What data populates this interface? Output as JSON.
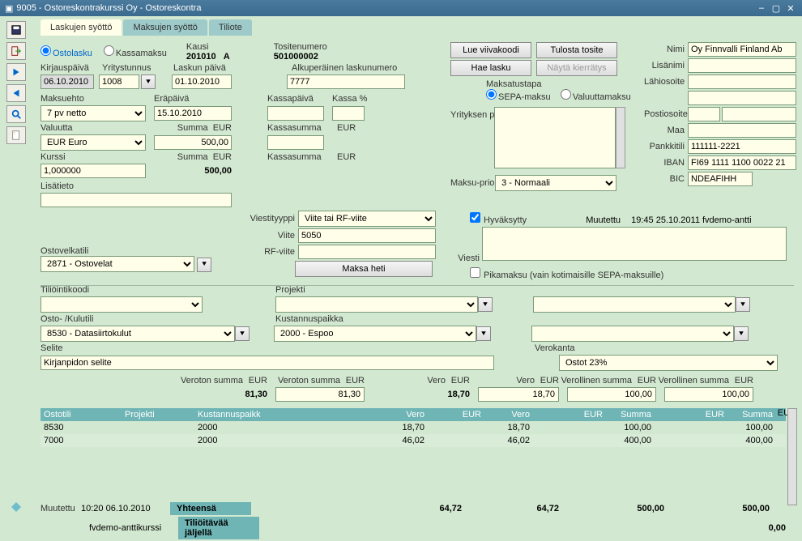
{
  "window": {
    "title": "9005 - Ostoreskontrakurssi Oy - Ostoreskontra"
  },
  "tabs": [
    "Laskujen syöttö",
    "Maksujen syöttö",
    "Tiliote"
  ],
  "radios": {
    "ostolasku": "Ostolasku",
    "kassamaksu": "Kassamaksu"
  },
  "lbl": {
    "kausi": "Kausi",
    "tositenumero": "Tositenumero",
    "kirjauspaiva": "Kirjauspäivä",
    "yritystunnus": "Yritystunnus",
    "laskunpaiva": "Laskun päivä",
    "alkuperainen": "Alkuperäinen laskunumero",
    "maksuehto": "Maksuehto",
    "erapaiva": "Eräpäivä",
    "kassapaiva": "Kassapäivä",
    "kassapct": "Kassa %",
    "valuutta": "Valuutta",
    "summa": "Summa",
    "kurssi": "Kurssi",
    "kassasumma": "Kassasumma",
    "lisatieto": "Lisätieto",
    "viestityyppi": "Viestityyppi",
    "viite": "Viite",
    "rfviite": "RF-viite",
    "ostovelkatili": "Ostovelkatili",
    "maksatapa": "Maksatustapa",
    "sepa": "SEPA-maksu",
    "valuutta_r": "Valuuttamaksu",
    "yrityksen": "Yrityksen pankkitilit",
    "maksupri": "Maksu-prioriteetti",
    "nimi": "Nimi",
    "lisanimi": "Lisänimi",
    "lahiosoite": "Lähiosoite",
    "postiosoite": "Postiosoite",
    "maa": "Maa",
    "pankkitili": "Pankkitili",
    "iban": "IBAN",
    "bic": "BIC",
    "hyvaksytty": "Hyväksytty",
    "muutettu": "Muutettu",
    "viesti": "Viesti",
    "pikamaksu": "Pikamaksu (vain kotimaisille SEPA-maksuille)",
    "tiliointikoodi": "Tiliöintikoodi",
    "projekti": "Projekti",
    "ostokulutili": "Osto- /Kulutili",
    "kustannuspaikka": "Kustannuspaikka",
    "selite": "Selite",
    "verokanta": "Verokanta",
    "veroton": "Veroton summa",
    "vero": "Vero",
    "verollinen": "Verollinen summa",
    "ostotili": "Ostotili",
    "kustp": "Kustannuspaikk",
    "yhteensa": "Yhteensä",
    "jaljella": "Tiliöitävää jäljellä"
  },
  "btns": {
    "lueviivakoodi": "Lue viivakoodi",
    "tulosta": "Tulosta tosite",
    "haelasku": "Hae lasku",
    "nayta": "Näytä kierrätys",
    "maksaheti": "Maksa heti"
  },
  "v": {
    "kausi": "201010",
    "kausi_s": "A",
    "tositenumero": "501000002",
    "kirjauspaiva": "06.10.2010",
    "yritystunnus": "1008",
    "laskunpaiva": "01.10.2010",
    "alkuperainen": "7777",
    "maksuehto": "7 pv netto",
    "erapaiva": "15.10.2010",
    "valuutta": "EUR Euro",
    "summa": "500,00",
    "kurssi": "1,000000",
    "summa2": "500,00",
    "kassasumma": "",
    "viestityyppi": "Viite tai RF-viite",
    "viite": "5050",
    "rfviite": "",
    "ostovelkatili": "2871 - Ostovelat",
    "maksupri": "3 - Normaali",
    "nimi": "Oy Finnvalli Finland Ab",
    "pankkitili": "111111-2221",
    "iban": "FI69 1111 1100 0022 21",
    "bic": "NDEAFIHH",
    "muutettu": "19:45 25.10.2011  fvdemo-antti",
    "ostokulutili": "8530 - Datasiirtokulut",
    "kustannuspaikka": "2000 - Espoo",
    "selite": "Kirjanpidon selite",
    "verokanta": "Ostot 23%",
    "eur": "EUR",
    "veroton1": "81,30",
    "veroton2": "81,30",
    "vero1": "18,70",
    "vero2": "18,70",
    "verol1": "100,00",
    "verol2": "100,00",
    "foot_muutettu": "10:20 06.10.2010",
    "foot_user": "fvdemo-anttikurssi",
    "tot_vero1": "64,72",
    "tot_vero2": "64,72",
    "tot_sum1": "500,00",
    "tot_sum2": "500,00",
    "jaljella": "0,00"
  },
  "rows": [
    {
      "ostotili": "8530",
      "projekti": "",
      "kp": "2000",
      "vero1": "18,70",
      "vero2": "18,70",
      "sum1": "100,00",
      "sum2": "100,00"
    },
    {
      "ostotili": "7000",
      "projekti": "",
      "kp": "2000",
      "vero1": "46,02",
      "vero2": "46,02",
      "sum1": "400,00",
      "sum2": "400,00"
    }
  ]
}
